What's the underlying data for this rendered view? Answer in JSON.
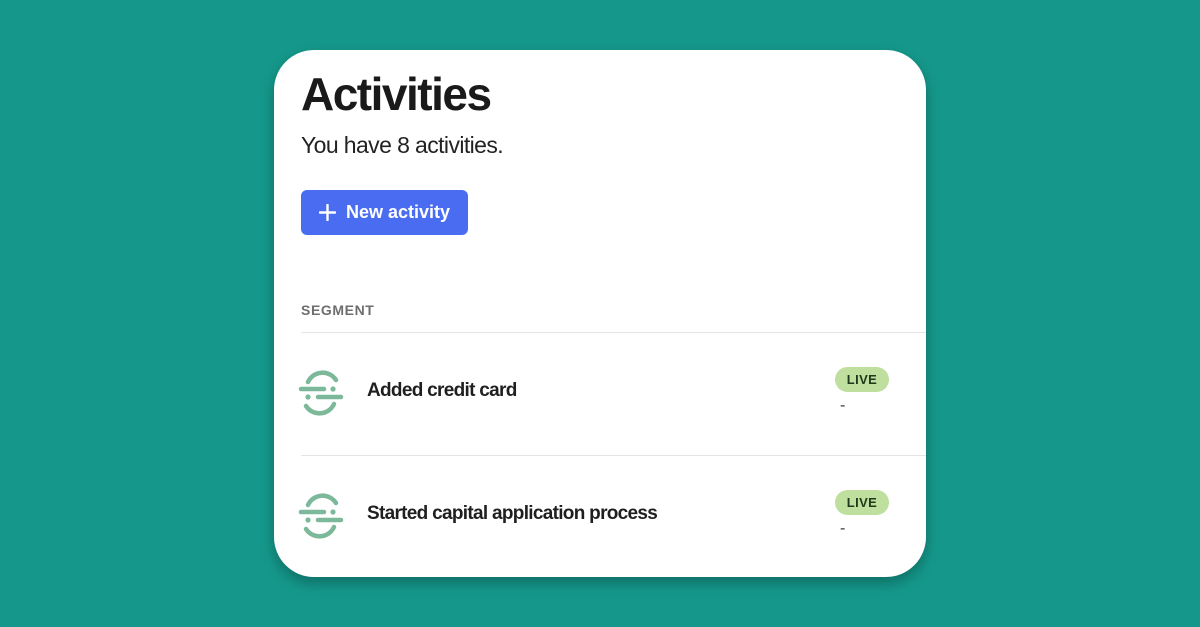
{
  "page": {
    "title": "Activities",
    "subtitle": "You have 8 activities."
  },
  "toolbar": {
    "new_button_label": "New activity",
    "new_button_icon": "plus-icon"
  },
  "section": {
    "label": "SEGMENT"
  },
  "activities": [
    {
      "name": "Added credit card",
      "status": "LIVE",
      "detail": "-",
      "icon": "segment-logo-icon"
    },
    {
      "name": "Started capital application process",
      "status": "LIVE",
      "detail": "-",
      "icon": "segment-logo-icon"
    }
  ],
  "colors": {
    "background": "#15988b",
    "card": "#ffffff",
    "accent": "#4a6cf0",
    "live_badge": "#bfdf9e",
    "segment_logo": "#7cb89a"
  }
}
